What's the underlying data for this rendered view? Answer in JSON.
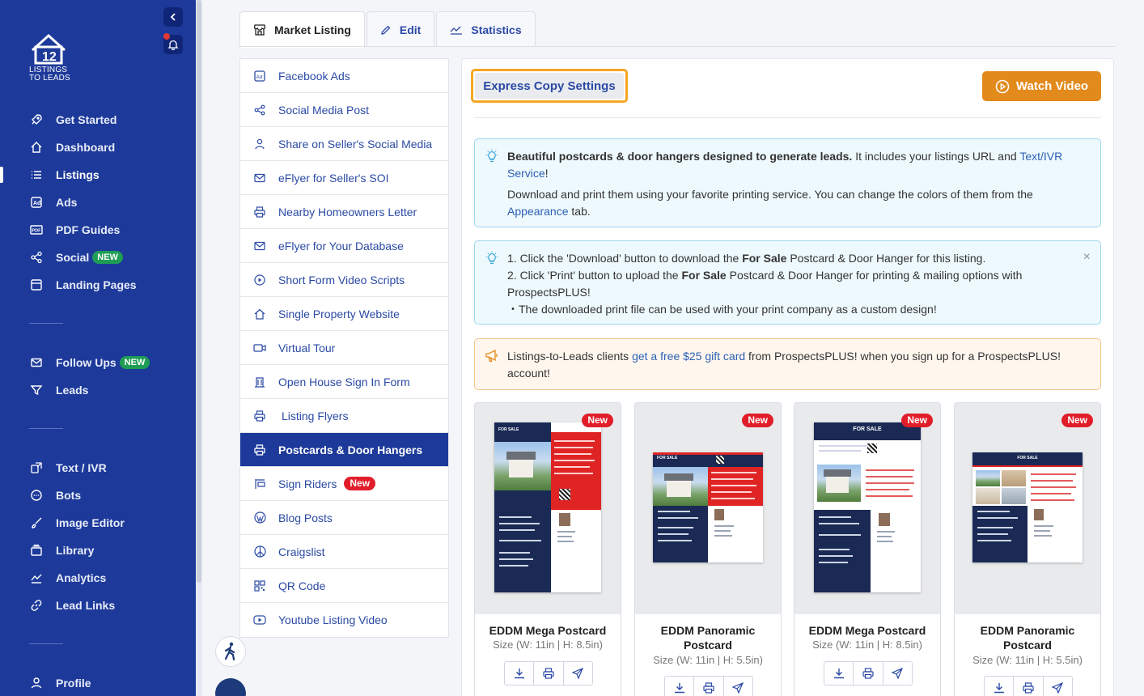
{
  "sidebar": {
    "logo_line1": "LISTINGS",
    "logo_line2": "TO LEADS",
    "items": [
      {
        "label": "Get Started",
        "icon": "rocket-icon"
      },
      {
        "label": "Dashboard",
        "icon": "home-icon"
      },
      {
        "label": "Listings",
        "icon": "list-icon"
      },
      {
        "label": "Ads",
        "icon": "ad-icon"
      },
      {
        "label": "PDF Guides",
        "icon": "pdf-icon"
      },
      {
        "label": "Social",
        "icon": "share-icon",
        "badge": "NEW"
      },
      {
        "label": "Landing Pages",
        "icon": "window-icon"
      },
      {
        "label": "Follow Ups",
        "icon": "mail-icon",
        "badge": "NEW"
      },
      {
        "label": "Leads",
        "icon": "filter-icon"
      },
      {
        "label": "Text / IVR",
        "icon": "chat-transfer-icon"
      },
      {
        "label": "Bots",
        "icon": "chat-bubble-icon"
      },
      {
        "label": "Image Editor",
        "icon": "brush-icon"
      },
      {
        "label": "Library",
        "icon": "library-icon"
      },
      {
        "label": "Analytics",
        "icon": "chart-line-icon"
      },
      {
        "label": "Lead Links",
        "icon": "link-icon"
      },
      {
        "label": "Profile",
        "icon": "user-icon"
      }
    ],
    "accent": "#1d3a9a"
  },
  "tabs": [
    {
      "label": "Market Listing",
      "icon": "storefront-icon"
    },
    {
      "label": "Edit",
      "icon": "pencil-icon"
    },
    {
      "label": "Statistics",
      "icon": "stats-icon"
    }
  ],
  "menu": [
    {
      "label": "Facebook Ads",
      "icon": "ad-icon"
    },
    {
      "label": "Social Media Post",
      "icon": "share-icon"
    },
    {
      "label": "Share on Seller's Social Media",
      "icon": "user-icon"
    },
    {
      "label": "eFlyer for Seller's SOI",
      "icon": "mail-icon"
    },
    {
      "label": "Nearby Homeowners Letter",
      "icon": "printer-icon"
    },
    {
      "label": "eFlyer for Your Database",
      "icon": "mail-icon"
    },
    {
      "label": "Short Form Video Scripts",
      "icon": "play-circle-icon"
    },
    {
      "label": "Single Property Website",
      "icon": "home-icon"
    },
    {
      "label": "Virtual Tour",
      "icon": "video-icon"
    },
    {
      "label": "Open House Sign In Form",
      "icon": "building-icon"
    },
    {
      "label": "Listing Flyers",
      "icon": "printer-icon"
    },
    {
      "label": "Postcards & Door Hangers",
      "icon": "printer-icon"
    },
    {
      "label": "Sign Riders",
      "icon": "sign-icon",
      "badge": "New"
    },
    {
      "label": "Blog Posts",
      "icon": "wordpress-icon"
    },
    {
      "label": "Craigslist",
      "icon": "peace-icon"
    },
    {
      "label": "QR Code",
      "icon": "qr-icon"
    },
    {
      "label": "Youtube Listing Video",
      "icon": "youtube-icon"
    }
  ],
  "express_copy_label": "Express Copy Settings",
  "watch_video_label": "Watch Video",
  "alert1": {
    "bold": "Beautiful postcards & door hangers designed to generate leads.",
    "text1": " It includes your listings URL and ",
    "link1": "Text/IVR Service",
    "text2": "!",
    "line2_text": "Download and print them using your favorite printing service. You can change the colors of them from the ",
    "link2": "Appearance",
    "line2_end": " tab."
  },
  "alert2": {
    "l1_a": "1. Click the 'Download' button to download the ",
    "l1_b": "For Sale",
    "l1_c": " Postcard & Door Hanger for this listing.",
    "l2_a": "2. Click 'Print' button to upload the ",
    "l2_b": "For Sale",
    "l2_c": " Postcard & Door Hanger for printing & mailing options with ProspectsPLUS!",
    "l3": "・The downloaded print file can be used with your print company as a custom design!",
    "close": "×"
  },
  "alert3": {
    "text1": "Listings-to-Leads clients ",
    "link": "get a free $25 gift card",
    "text2": " from ProspectsPLUS! when you sign up for a ProspectsPLUS! account!"
  },
  "cards": [
    {
      "title": "EDDM Mega Postcard",
      "size": "Size (W: 11in | H: 8.5in)",
      "badge": "New",
      "thumb_text": "FOR SALE"
    },
    {
      "title": "EDDM Panoramic Postcard",
      "size": "Size (W: 11in | H: 5.5in)",
      "badge": "New",
      "thumb_text": "FOR SALE"
    },
    {
      "title": "EDDM Mega Postcard",
      "size": "Size (W: 11in | H: 8.5in)",
      "badge": "New",
      "thumb_text": "FOR SALE"
    },
    {
      "title": "EDDM Panoramic Postcard",
      "size": "Size (W: 11in | H: 5.5in)",
      "badge": "New",
      "thumb_text": "FOR SALE"
    }
  ],
  "colors": {
    "orange": "#e38a1c",
    "red_badge": "#e11d2a",
    "green_badge": "#1f9d55",
    "link": "#2b4aa5"
  }
}
